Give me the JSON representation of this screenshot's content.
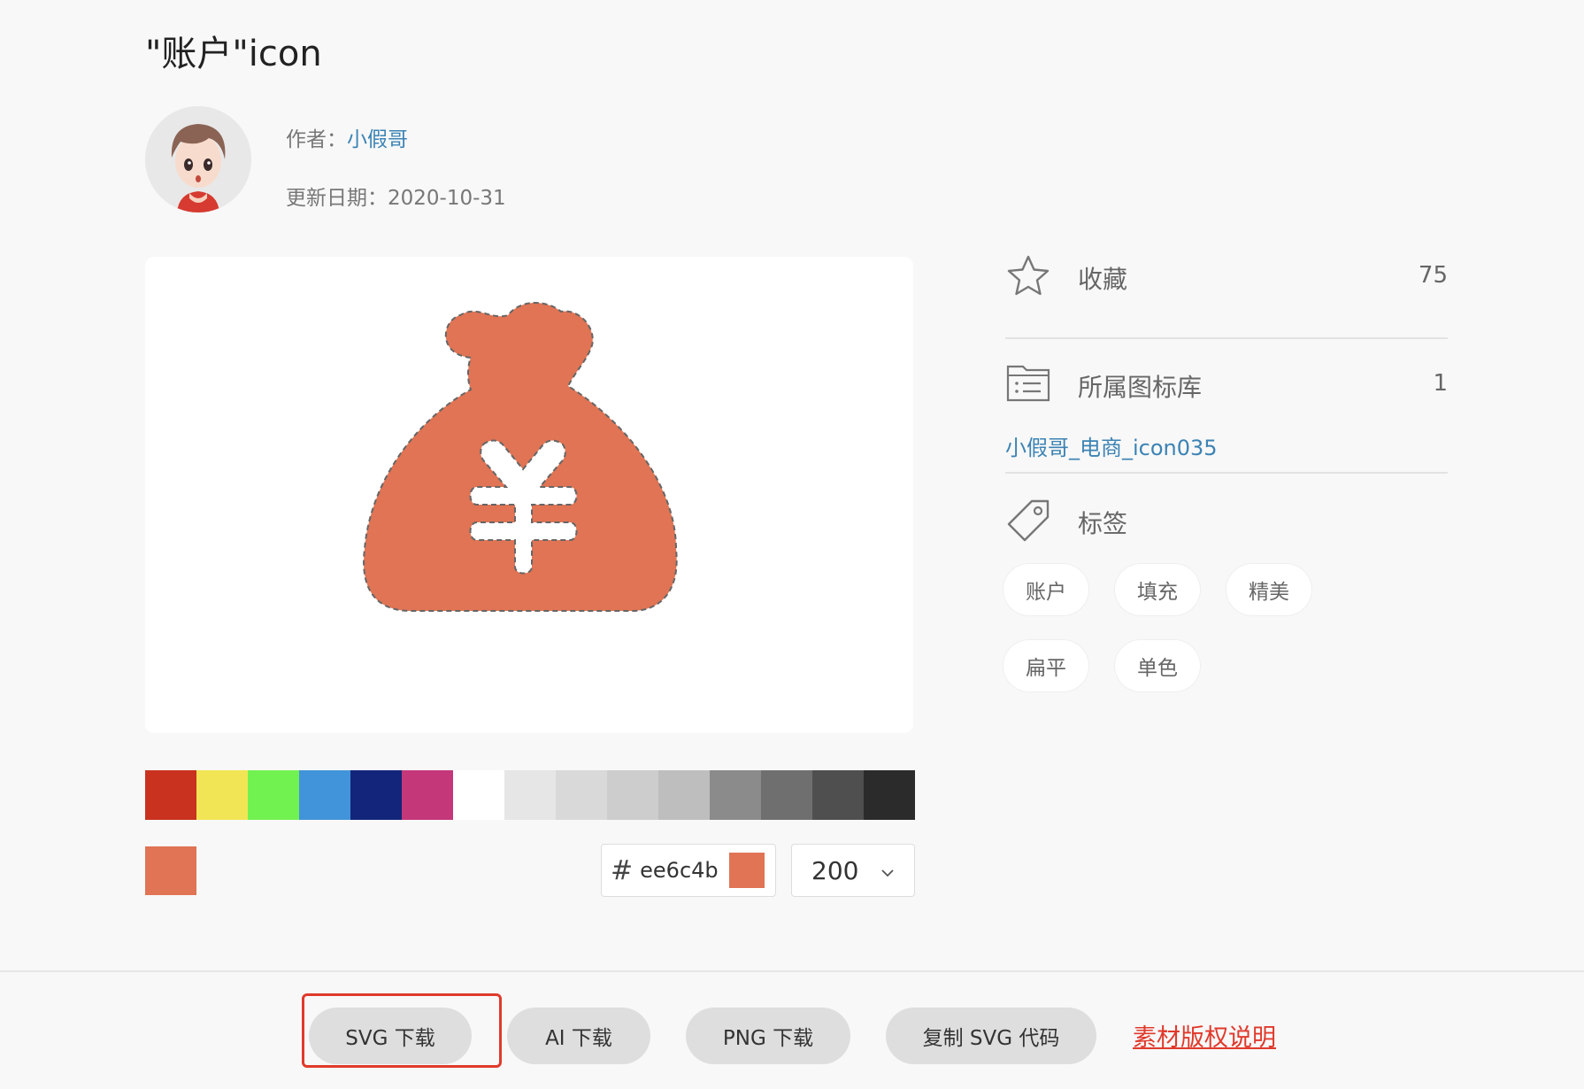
{
  "page": {
    "title": "\"账户\"icon"
  },
  "author": {
    "label": "作者：",
    "name": "小假哥"
  },
  "updated": {
    "label": "更新日期：",
    "value": "2020-10-31"
  },
  "icon": {
    "color": "#e07454",
    "name": "money-bag-yuan-icon"
  },
  "palette": [
    "#c8321f",
    "#f2e555",
    "#71f251",
    "#4194d9",
    "#13257a",
    "#c43779",
    "#ffffff",
    "#e6e6e6",
    "#d9d9d9",
    "#cdcdcd",
    "#bebebe",
    "#8b8b8b",
    "#6f6f6f",
    "#4f4f4f",
    "#2b2b2b"
  ],
  "color_picker": {
    "hash": "#",
    "hex": "ee6c4b",
    "chip_color": "#e07454"
  },
  "size_select": {
    "value": "200"
  },
  "sidebar": {
    "favorite": {
      "label": "收藏",
      "count": "75",
      "icon": "star-icon"
    },
    "library": {
      "label": "所属图标库",
      "count": "1",
      "icon": "folder-list-icon",
      "link": "小假哥_电商_icon035"
    },
    "tags": {
      "label": "标签",
      "icon": "tag-icon",
      "items": [
        "账户",
        "填充",
        "精美",
        "扁平",
        "单色"
      ]
    }
  },
  "actions": {
    "svg": "SVG 下载",
    "ai": "AI 下载",
    "png": "PNG 下载",
    "copy": "复制 SVG 代码",
    "copyright": "素材版权说明"
  }
}
